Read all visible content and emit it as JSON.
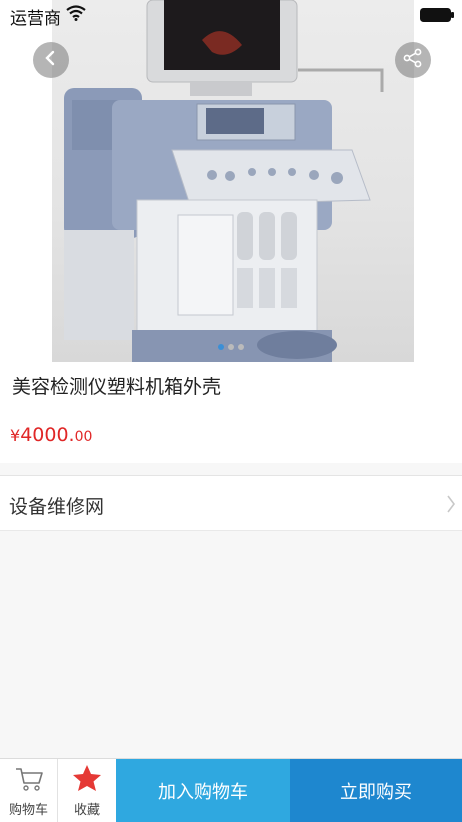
{
  "status_bar": {
    "carrier": "运营商"
  },
  "product": {
    "title": "美容检测仪塑料机箱外壳",
    "price_symbol": "¥",
    "price_integer": "4000.",
    "price_decimal": "00"
  },
  "carousel": {
    "count": 3,
    "active_index": 0
  },
  "store": {
    "name": "设备维修网"
  },
  "bottom_bar": {
    "cart_label": "购物车",
    "favorite_label": "收藏",
    "add_to_cart_label": "加入购物车",
    "buy_now_label": "立即购买"
  },
  "colors": {
    "price": "#e02727",
    "add_to_cart_bg": "#2fa8e0",
    "buy_now_bg": "#1e87cf",
    "favorite_star": "#e53935",
    "carousel_active": "#3b8fd6"
  },
  "icons": {
    "back": "chevron-left-icon",
    "share": "share-icon",
    "cart": "cart-icon",
    "favorite": "star-icon",
    "store_arrow": "chevron-right-icon"
  }
}
